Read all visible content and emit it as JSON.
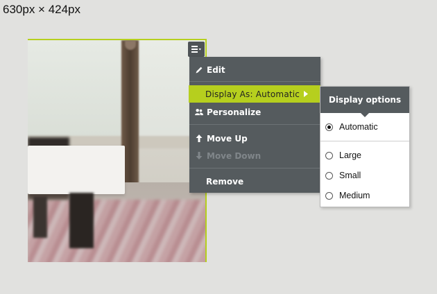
{
  "dimension_label": "630px × 424px",
  "tile": {
    "menu_button_icon": "list-menu-icon"
  },
  "menu": {
    "items": [
      {
        "label": "Edit",
        "icon": "pencil-icon",
        "enabled": true
      },
      {
        "label": "Display As: Automatic",
        "icon": "chevron-right-icon",
        "enabled": true,
        "active": true
      },
      {
        "label": "Personalize",
        "icon": "people-icon",
        "enabled": true
      },
      {
        "label": "Move Up",
        "icon": "arrow-up-icon",
        "enabled": true
      },
      {
        "label": "Move Down",
        "icon": "arrow-down-icon",
        "enabled": false
      },
      {
        "label": "Remove",
        "icon": "",
        "enabled": true
      }
    ]
  },
  "submenu": {
    "title": "Display options",
    "options": [
      {
        "label": "Automatic",
        "selected": true
      },
      {
        "label": "Large",
        "selected": false
      },
      {
        "label": "Small",
        "selected": false
      },
      {
        "label": "Medium",
        "selected": false
      }
    ]
  },
  "colors": {
    "accent": "#b6cf1e",
    "menu_bg": "#555b5e",
    "disabled_text": "#80868a"
  }
}
